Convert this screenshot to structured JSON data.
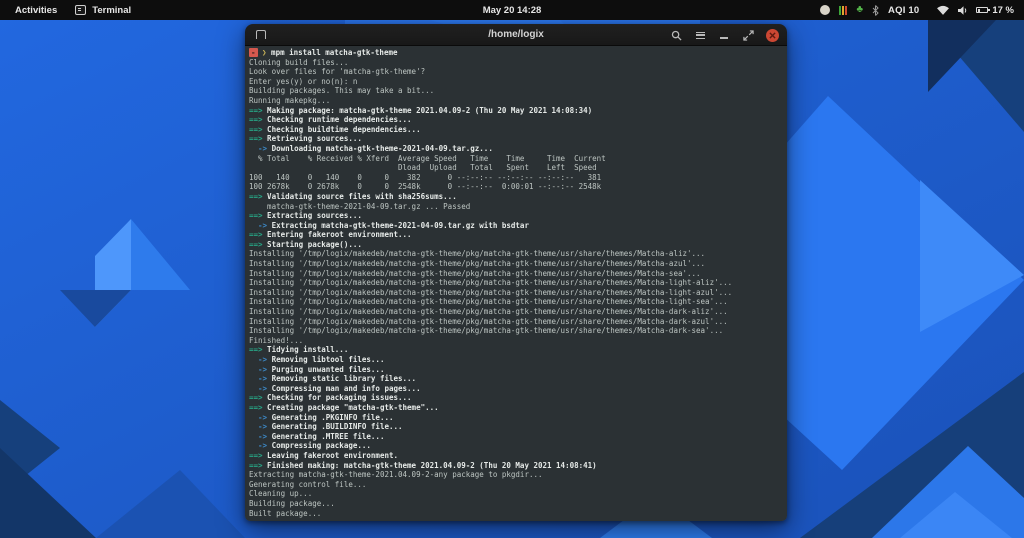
{
  "top_bar": {
    "activities_label": "Activities",
    "app_name": "Terminal",
    "clock": "May 20 14:28",
    "aqi_label": "AQI 10",
    "battery_percent": "17 %"
  },
  "colors": {
    "desktop_base": "#2166dd",
    "terminal_background": "#2b3134",
    "makepkg_green": "#27a385",
    "step_arrow_blue": "#3d87c4",
    "prompt_badge_red": "#d4584e",
    "prompt_chevron_yellow": "#c9b458",
    "close_button_red": "#cc4733"
  },
  "window": {
    "title": "/home/logix"
  },
  "terminal": {
    "lines": [
      [
        [
          "rb",
          "-"
        ],
        [
          "t",
          " "
        ],
        [
          "y",
          "❯"
        ],
        [
          "w",
          " mpm install matcha-gtk-theme"
        ]
      ],
      [
        [
          "t",
          "Cloning build files..."
        ]
      ],
      [
        [
          "t",
          "Look over files for 'matcha-gtk-theme'?"
        ]
      ],
      [
        [
          "t",
          "Enter yes(y) or no(n): n"
        ]
      ],
      [
        [
          "t",
          "Building packages. This may take a bit..."
        ]
      ],
      [
        [
          "t",
          "Running makepkg..."
        ]
      ],
      [
        [
          "g",
          "==>"
        ],
        [
          "w",
          " Making package: matcha-gtk-theme 2021.04.09-2 (Thu 20 May 2021 14:08:34)"
        ]
      ],
      [
        [
          "g",
          "==>"
        ],
        [
          "w",
          " Checking runtime dependencies..."
        ]
      ],
      [
        [
          "g",
          "==>"
        ],
        [
          "w",
          " Checking buildtime dependencies..."
        ]
      ],
      [
        [
          "g",
          "==>"
        ],
        [
          "w",
          " Retrieving sources..."
        ]
      ],
      [
        [
          "a",
          "  ->"
        ],
        [
          "w",
          " Downloading matcha-gtk-theme-2021-04-09.tar.gz..."
        ]
      ],
      [
        [
          "t",
          "  % Total    % Received % Xferd  Average Speed   Time    Time     Time  Current"
        ]
      ],
      [
        [
          "t",
          "                                 Dload  Upload   Total   Spent    Left  Speed"
        ]
      ],
      [
        [
          "t",
          "100   140    0   140    0     0    382      0 --:--:-- --:--:-- --:--:--   381"
        ]
      ],
      [
        [
          "t",
          "100 2678k    0 2678k    0     0  2548k      0 --:--:--  0:00:01 --:--:-- 2548k"
        ]
      ],
      [
        [
          "g",
          "==>"
        ],
        [
          "w",
          " Validating source files with sha256sums..."
        ]
      ],
      [
        [
          "t",
          "    matcha-gtk-theme-2021-04-09.tar.gz ... Passed"
        ]
      ],
      [
        [
          "g",
          "==>"
        ],
        [
          "w",
          " Extracting sources..."
        ]
      ],
      [
        [
          "a",
          "  ->"
        ],
        [
          "w",
          " Extracting matcha-gtk-theme-2021-04-09.tar.gz with bsdtar"
        ]
      ],
      [
        [
          "g",
          "==>"
        ],
        [
          "w",
          " Entering fakeroot environment..."
        ]
      ],
      [
        [
          "g",
          "==>"
        ],
        [
          "w",
          " Starting package()..."
        ]
      ],
      [
        [
          "t",
          "Installing '/tmp/logix/makedeb/matcha-gtk-theme/pkg/matcha-gtk-theme/usr/share/themes/Matcha-aliz'..."
        ]
      ],
      [
        [
          "t",
          "Installing '/tmp/logix/makedeb/matcha-gtk-theme/pkg/matcha-gtk-theme/usr/share/themes/Matcha-azul'..."
        ]
      ],
      [
        [
          "t",
          "Installing '/tmp/logix/makedeb/matcha-gtk-theme/pkg/matcha-gtk-theme/usr/share/themes/Matcha-sea'..."
        ]
      ],
      [
        [
          "t",
          "Installing '/tmp/logix/makedeb/matcha-gtk-theme/pkg/matcha-gtk-theme/usr/share/themes/Matcha-light-aliz'..."
        ]
      ],
      [
        [
          "t",
          "Installing '/tmp/logix/makedeb/matcha-gtk-theme/pkg/matcha-gtk-theme/usr/share/themes/Matcha-light-azul'..."
        ]
      ],
      [
        [
          "t",
          "Installing '/tmp/logix/makedeb/matcha-gtk-theme/pkg/matcha-gtk-theme/usr/share/themes/Matcha-light-sea'..."
        ]
      ],
      [
        [
          "t",
          "Installing '/tmp/logix/makedeb/matcha-gtk-theme/pkg/matcha-gtk-theme/usr/share/themes/Matcha-dark-aliz'..."
        ]
      ],
      [
        [
          "t",
          "Installing '/tmp/logix/makedeb/matcha-gtk-theme/pkg/matcha-gtk-theme/usr/share/themes/Matcha-dark-azul'..."
        ]
      ],
      [
        [
          "t",
          "Installing '/tmp/logix/makedeb/matcha-gtk-theme/pkg/matcha-gtk-theme/usr/share/themes/Matcha-dark-sea'..."
        ]
      ],
      [
        [
          "t",
          "Finished!..."
        ]
      ],
      [
        [
          "g",
          "==>"
        ],
        [
          "w",
          " Tidying install..."
        ]
      ],
      [
        [
          "a",
          "  ->"
        ],
        [
          "w",
          " Removing libtool files..."
        ]
      ],
      [
        [
          "a",
          "  ->"
        ],
        [
          "w",
          " Purging unwanted files..."
        ]
      ],
      [
        [
          "a",
          "  ->"
        ],
        [
          "w",
          " Removing static library files..."
        ]
      ],
      [
        [
          "a",
          "  ->"
        ],
        [
          "w",
          " Compressing man and info pages..."
        ]
      ],
      [
        [
          "g",
          "==>"
        ],
        [
          "w",
          " Checking for packaging issues..."
        ]
      ],
      [
        [
          "g",
          "==>"
        ],
        [
          "w",
          " Creating package \"matcha-gtk-theme\"..."
        ]
      ],
      [
        [
          "a",
          "  ->"
        ],
        [
          "w",
          " Generating .PKGINFO file..."
        ]
      ],
      [
        [
          "a",
          "  ->"
        ],
        [
          "w",
          " Generating .BUILDINFO file..."
        ]
      ],
      [
        [
          "a",
          "  ->"
        ],
        [
          "w",
          " Generating .MTREE file..."
        ]
      ],
      [
        [
          "a",
          "  ->"
        ],
        [
          "w",
          " Compressing package..."
        ]
      ],
      [
        [
          "g",
          "==>"
        ],
        [
          "w",
          " Leaving fakeroot environment."
        ]
      ],
      [
        [
          "g",
          "==>"
        ],
        [
          "w",
          " Finished making: matcha-gtk-theme 2021.04.09-2 (Thu 20 May 2021 14:08:41)"
        ]
      ],
      [
        [
          "t",
          "Extracting matcha-gtk-theme-2021.04.09-2-any package to pkgdir..."
        ]
      ],
      [
        [
          "t",
          "Generating control file..."
        ]
      ],
      [
        [
          "t",
          "Cleaning up..."
        ]
      ],
      [
        [
          "t",
          "Building package..."
        ]
      ],
      [
        [
          "t",
          "Built package..."
        ]
      ]
    ]
  }
}
